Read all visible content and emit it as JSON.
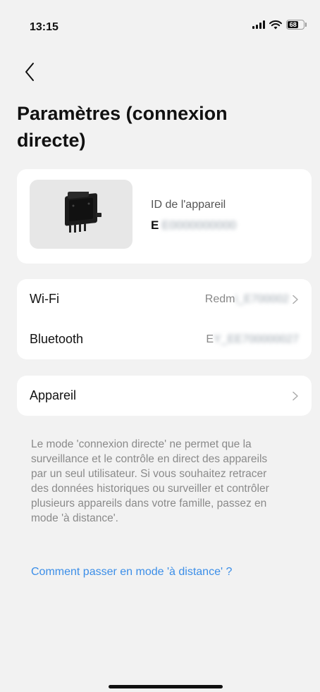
{
  "status_bar": {
    "time": "13:15",
    "battery_level": "68",
    "icons": [
      "signal-icon",
      "wifi-icon",
      "battery-icon"
    ]
  },
  "header": {
    "back_icon": "chevron-left-icon",
    "title": "Paramètres (connexion directe)"
  },
  "device_card": {
    "image": "micro-inverter-device",
    "id_label": "ID de l'appareil",
    "id_prefix": "E",
    "id_value_blurred": "E0000000000"
  },
  "connection": {
    "wifi": {
      "label": "Wi-Fi",
      "value_prefix": "Redm",
      "value_blurred": "i_E700002"
    },
    "bluetooth": {
      "label": "Bluetooth",
      "value_prefix": "E",
      "value_blurred": "Y_EE700000027"
    }
  },
  "device_row": {
    "label": "Appareil"
  },
  "info": {
    "text": "Le mode 'connexion directe' ne permet que la surveillance et le contrôle en direct des appareils par un seul utilisateur. Si vous souhaitez retracer des données historiques ou surveiller et contrôler plusieurs appareils dans votre famille, passez en mode 'à distance'.",
    "link": "Comment passer en mode 'à distance' ?"
  },
  "colors": {
    "background": "#f2f2f2",
    "card": "#ffffff",
    "link": "#3b8ee8",
    "muted_text": "#8a8a8a"
  }
}
